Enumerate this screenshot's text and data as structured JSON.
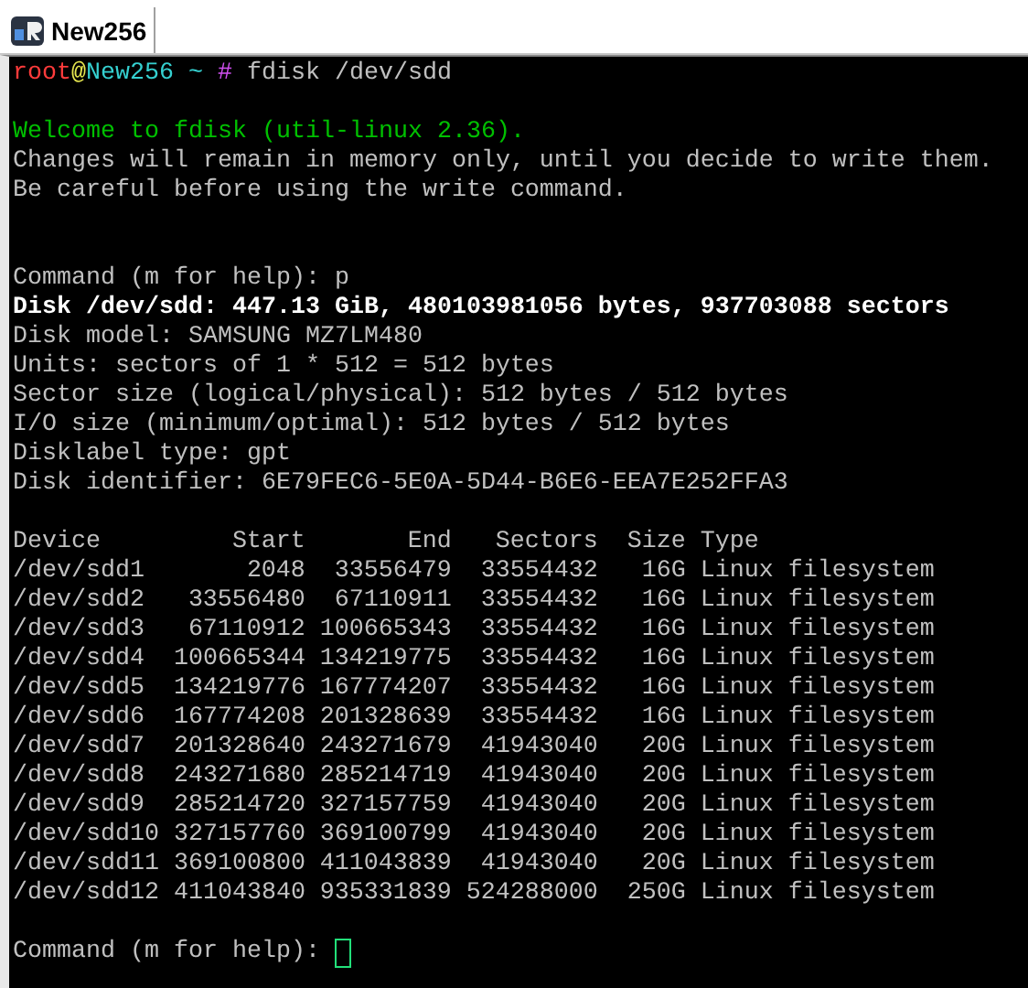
{
  "tabs": [
    {
      "label": "New256",
      "selected": true
    }
  ],
  "terminal": {
    "prompt": {
      "user": "root",
      "at": "@",
      "host": "New256",
      "path": "~",
      "symbol": "#",
      "command": "fdisk /dev/sdd"
    },
    "lines": [
      {
        "kind": "blank"
      },
      {
        "kind": "welcome",
        "text": "Welcome to fdisk (util-linux 2.36)."
      },
      {
        "kind": "normal",
        "text": "Changes will remain in memory only, until you decide to write them."
      },
      {
        "kind": "normal",
        "text": "Be careful before using the write command."
      },
      {
        "kind": "blank"
      },
      {
        "kind": "blank"
      },
      {
        "kind": "normal",
        "text": "Command (m for help): p"
      },
      {
        "kind": "bold",
        "text": "Disk /dev/sdd: 447.13 GiB, 480103981056 bytes, 937703088 sectors"
      },
      {
        "kind": "normal",
        "text": "Disk model: SAMSUNG MZ7LM480"
      },
      {
        "kind": "normal",
        "text": "Units: sectors of 1 * 512 = 512 bytes"
      },
      {
        "kind": "normal",
        "text": "Sector size (logical/physical): 512 bytes / 512 bytes"
      },
      {
        "kind": "normal",
        "text": "I/O size (minimum/optimal): 512 bytes / 512 bytes"
      },
      {
        "kind": "normal",
        "text": "Disklabel type: gpt"
      },
      {
        "kind": "normal",
        "text": "Disk identifier: 6E79FEC6-5E0A-5D44-B6E6-EEA7E252FFA3"
      },
      {
        "kind": "blank"
      }
    ],
    "table": {
      "columns": [
        "Device",
        "Start",
        "End",
        "Sectors",
        "Size",
        "Type"
      ],
      "rows": [
        [
          "/dev/sdd1",
          "2048",
          "33556479",
          "33554432",
          "16G",
          "Linux filesystem"
        ],
        [
          "/dev/sdd2",
          "33556480",
          "67110911",
          "33554432",
          "16G",
          "Linux filesystem"
        ],
        [
          "/dev/sdd3",
          "67110912",
          "100665343",
          "33554432",
          "16G",
          "Linux filesystem"
        ],
        [
          "/dev/sdd4",
          "100665344",
          "134219775",
          "33554432",
          "16G",
          "Linux filesystem"
        ],
        [
          "/dev/sdd5",
          "134219776",
          "167774207",
          "33554432",
          "16G",
          "Linux filesystem"
        ],
        [
          "/dev/sdd6",
          "167774208",
          "201328639",
          "33554432",
          "16G",
          "Linux filesystem"
        ],
        [
          "/dev/sdd7",
          "201328640",
          "243271679",
          "41943040",
          "20G",
          "Linux filesystem"
        ],
        [
          "/dev/sdd8",
          "243271680",
          "285214719",
          "41943040",
          "20G",
          "Linux filesystem"
        ],
        [
          "/dev/sdd9",
          "285214720",
          "327157759",
          "41943040",
          "20G",
          "Linux filesystem"
        ],
        [
          "/dev/sdd10",
          "327157760",
          "369100799",
          "41943040",
          "20G",
          "Linux filesystem"
        ],
        [
          "/dev/sdd11",
          "369100800",
          "411043839",
          "41943040",
          "20G",
          "Linux filesystem"
        ],
        [
          "/dev/sdd12",
          "411043840",
          "935331839",
          "524288000",
          "250G",
          "Linux filesystem"
        ]
      ]
    },
    "input_prompt": "Command (m for help):"
  }
}
